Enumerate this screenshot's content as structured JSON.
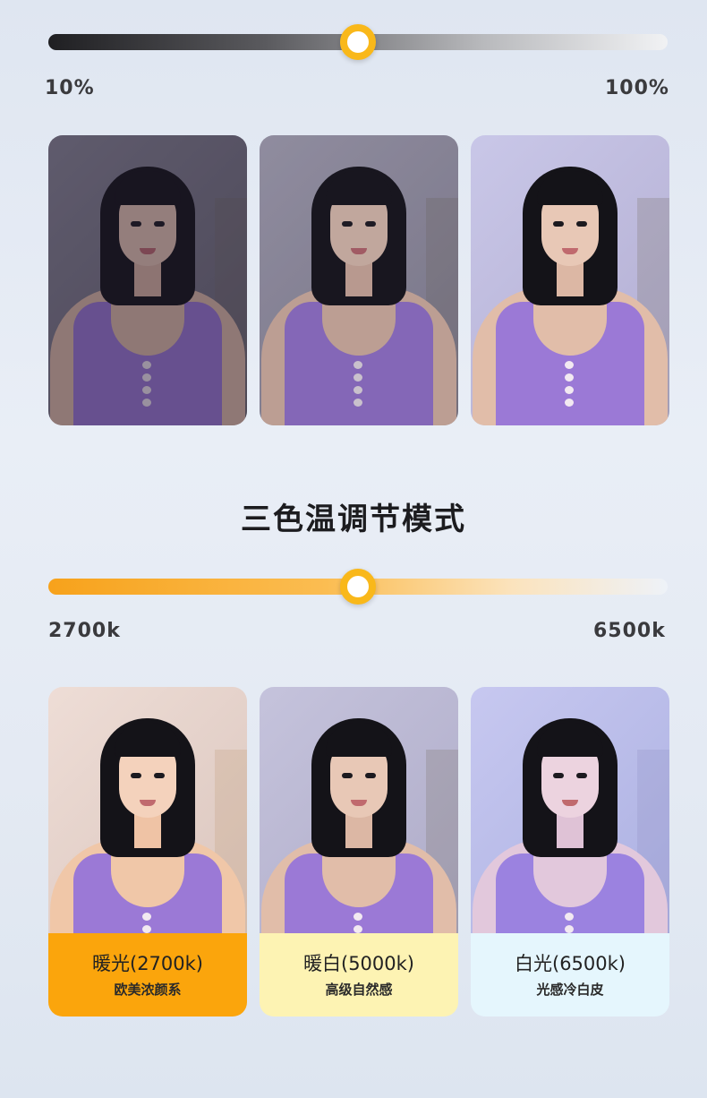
{
  "brightness": {
    "min_label": "10%",
    "max_label": "100%",
    "value_percent": 50
  },
  "temperature": {
    "title": "三色温调节模式",
    "min_label": "2700k",
    "max_label": "6500k",
    "value_percent": 50
  },
  "brightness_cards": [
    {
      "level": "low"
    },
    {
      "level": "medium"
    },
    {
      "level": "high"
    }
  ],
  "temperature_cards": [
    {
      "title": "暖光(2700k)",
      "subtitle": "欧美浓颜系",
      "color": "#fba50c"
    },
    {
      "title": "暖白(5000k)",
      "subtitle": "高级自然感",
      "color": "#fdf3b3"
    },
    {
      "title": "白光(6500k)",
      "subtitle": "光感冷白皮",
      "color": "#e5f6fd"
    }
  ],
  "colors": {
    "knob_ring": "#f9b81a",
    "warm_track": "#f7a21b"
  }
}
